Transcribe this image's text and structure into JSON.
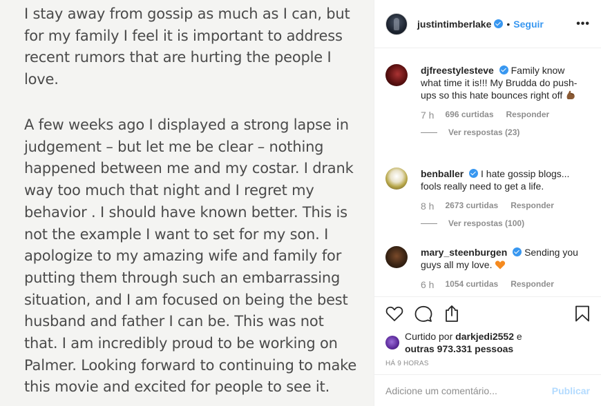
{
  "post_image": {
    "paragraph1": [
      "I stay away from gossip as much as I can, but",
      "for my family I feel it is important to address",
      "recent rumors that are hurting the people I",
      "love."
    ],
    "paragraph2": [
      "A few weeks ago I displayed a strong lapse in",
      "judgement – but let me be clear – nothing",
      "happened between me and my costar. I drank",
      "way too much that night and I regret my",
      "behavior . I should have known better. This is",
      "not the example I want to set for my son. I",
      "apologize to my amazing wife and family for",
      "putting them through such an embarrassing",
      "situation, and I am focused on being the best",
      "husband and father I can be. This was not",
      "that. I am incredibly proud to be working on",
      "Palmer. Looking forward to continuing to make",
      "this movie and excited for people to see it."
    ]
  },
  "header": {
    "username": "justintimberlake",
    "separator": "•",
    "follow_label": "Seguir",
    "more_label": "•••"
  },
  "comments": [
    {
      "username": "djfreestylesteve",
      "text": "Family know what time it is!!! My Brudda do push-ups so this hate bounces right off",
      "emoji": "flexed-biceps-icon",
      "time": "7 h",
      "likes": "696 curtidas",
      "reply_label": "Responder",
      "view_replies": "Ver respostas (23)"
    },
    {
      "username": "benballer",
      "text": "I hate gossip blogs... fools really need to get a life.",
      "time": "8 h",
      "likes": "2673 curtidas",
      "reply_label": "Responder",
      "view_replies": "Ver respostas (100)"
    },
    {
      "username": "mary_steenburgen",
      "text": "Sending you guys all my love.",
      "emoji": "orange-heart-icon",
      "time": "6 h",
      "likes": "1054 curtidas",
      "reply_label": "Responder"
    }
  ],
  "likes": {
    "prefix": "Curtido por",
    "user": "darkjedi2552",
    "conj": "e",
    "others": "outras 973.331 pessoas"
  },
  "timestamp": "HÁ 9 HORAS",
  "add_comment": {
    "placeholder": "Adicione um comentário...",
    "publish_label": "Publicar"
  },
  "colors": {
    "accent": "#3897f0",
    "publish_disabled": "#b3dbff",
    "muted": "#8e8e8e",
    "text": "#262626"
  }
}
